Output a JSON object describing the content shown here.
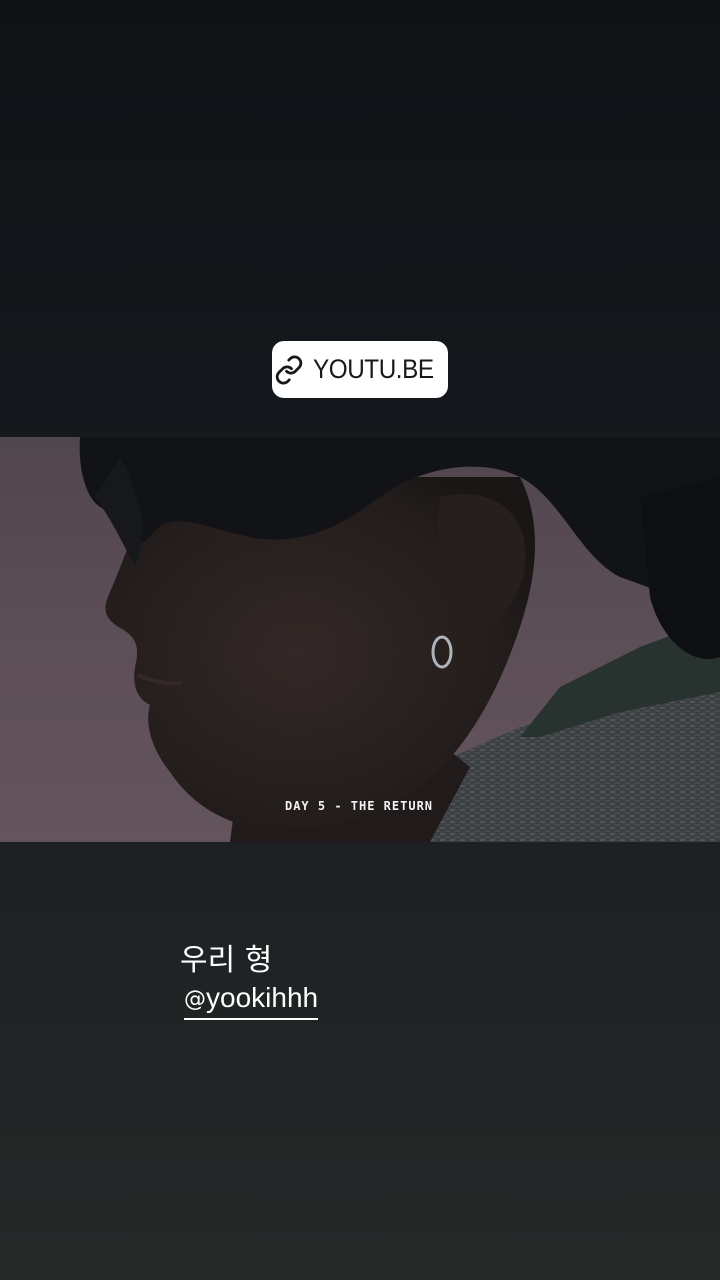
{
  "link_sticker": {
    "label": "YOUTU.BE",
    "icon": "link-icon"
  },
  "photo": {
    "caption": "DAY 5 - THE RETURN"
  },
  "story_text": {
    "caption": "우리 형",
    "mention_prefix": "@",
    "mention_handle": "yookihhh",
    "mention_icon": "threads-icon"
  },
  "colors": {
    "background_top": "#101316",
    "background_bottom": "#262828",
    "sticker_bg": "#ffffff",
    "sticker_text": "#16191c"
  }
}
